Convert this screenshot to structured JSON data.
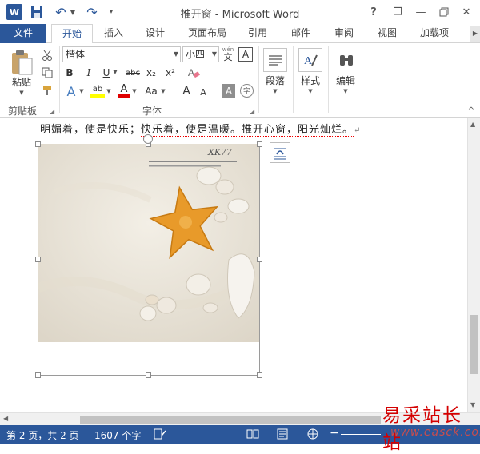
{
  "window": {
    "title": "推开窗 - Microsoft Word",
    "word_icon": "W",
    "help": "?",
    "minimize": "—",
    "restore": "❐",
    "close": "✕"
  },
  "tabs": [
    "文件",
    "开始",
    "插入",
    "设计",
    "页面布局",
    "引用",
    "邮件",
    "审阅",
    "视图",
    "加载项"
  ],
  "ribbon": {
    "clipboard": {
      "paste_label": "粘贴",
      "group_label": "剪贴板"
    },
    "font": {
      "font_name": "楷体",
      "font_size": "小四",
      "wen_label": "wén",
      "wen_char": "文",
      "frame_char": "A",
      "bold": "B",
      "italic": "I",
      "underline": "U",
      "strike": "abc",
      "subscript": "x₂",
      "superscript": "x²",
      "text_effects": "A",
      "highlight": "ab",
      "font_color": "A",
      "change_case": "Aa",
      "grow": "A",
      "shrink": "A",
      "shading": "A",
      "enclose": "字",
      "group_label": "字体"
    },
    "paragraph": {
      "label": "段落"
    },
    "styles": {
      "label": "样式"
    },
    "editing": {
      "label": "编辑"
    }
  },
  "document": {
    "text_before": "明媚着，使是快乐；",
    "text_after": "快乐着，使是温暖。推开心窗，阳光灿烂。",
    "paragraph_mark": "↵",
    "photo_caption": "XK77"
  },
  "status": {
    "page": "第 2 页，共 2 页",
    "words": "1607 个字"
  },
  "watermark": {
    "cn": "易采站长站",
    "url": "www.easck.com"
  },
  "colors": {
    "accent": "#2b579a",
    "highlight": "#ffff00",
    "font_color": "#e00000",
    "watermark": "#d40000"
  }
}
